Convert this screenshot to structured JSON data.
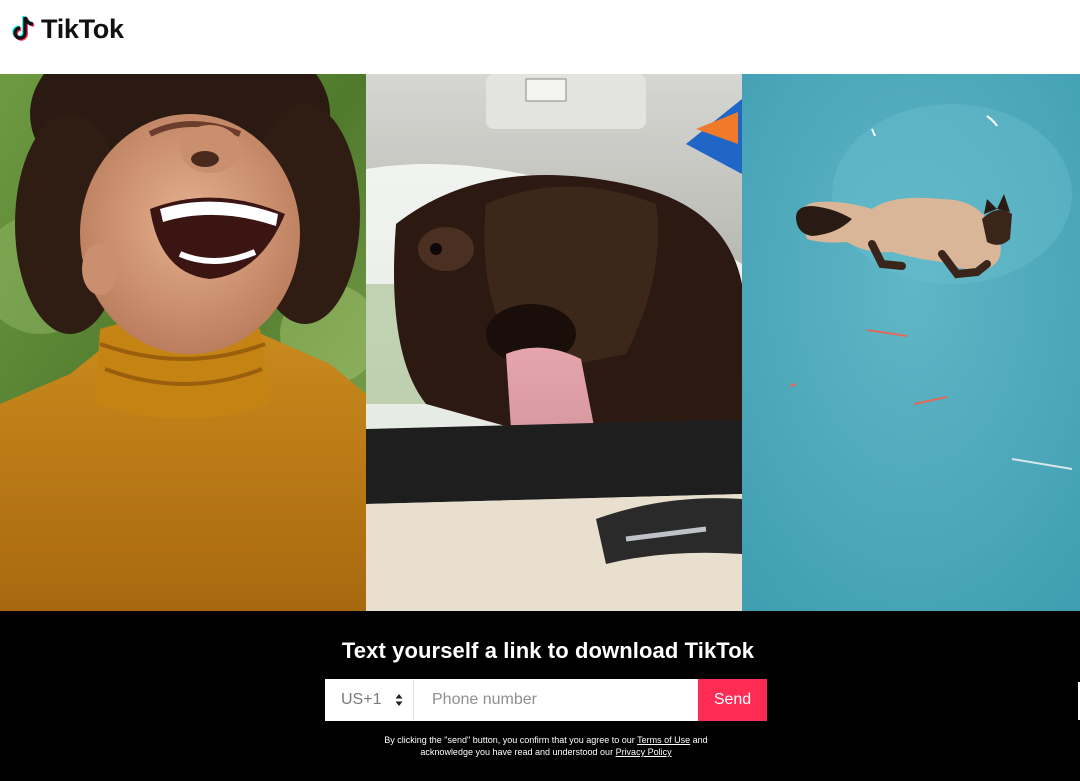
{
  "brand": {
    "name": "TikTok",
    "icon": "tiktok-note-icon",
    "accent_cyan": "#25f4ee",
    "accent_pink": "#fe2c55"
  },
  "gallery": {
    "panels": [
      {
        "name": "laughing-person-video"
      },
      {
        "name": "bison-car-window-video"
      },
      {
        "name": "cat-on-ice-video"
      }
    ]
  },
  "signup": {
    "title": "Text yourself a link to download TikTok",
    "country_code": "US+1",
    "country_caret_icon": "sort-caret-icon",
    "phone_placeholder": "Phone number",
    "send_label": "Send",
    "legal_pre": "By clicking the \"send\" button, you confirm that you agree to our ",
    "terms_link": "Terms of Use",
    "legal_mid": " and",
    "legal_line2": "acknowledge you have read and understood our ",
    "privacy_link": "Privacy Policy"
  }
}
